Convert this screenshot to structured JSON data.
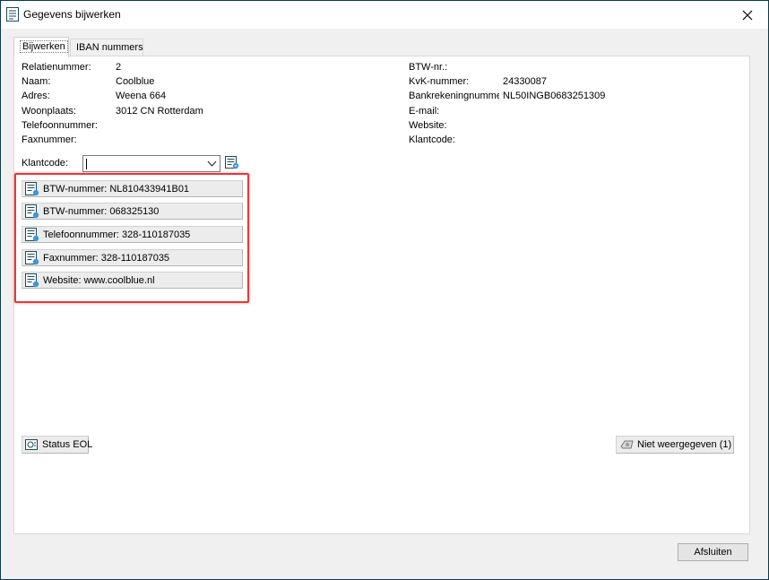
{
  "window": {
    "title": "Gegevens bijwerken",
    "close_label": "×"
  },
  "tabs": [
    {
      "label": "Bijwerken",
      "active": true
    },
    {
      "label": "IBAN nummers",
      "active": false
    }
  ],
  "left_fields": [
    {
      "label": "Relatienummer:",
      "value": "2"
    },
    {
      "label": "Naam:",
      "value": "Coolblue"
    },
    {
      "label": "Adres:",
      "value": "Weena 664"
    },
    {
      "label": "Woonplaats:",
      "value": "3012 CN Rotterdam"
    },
    {
      "label": "Telefoonnummer:",
      "value": ""
    },
    {
      "label": "Faxnummer:",
      "value": ""
    }
  ],
  "right_fields": [
    {
      "label": "BTW-nr.:",
      "value": ""
    },
    {
      "label": "KvK-nummer:",
      "value": "24330087"
    },
    {
      "label": "Bankrekeningnummer:",
      "value": "NL50INGB0683251309"
    },
    {
      "label": "E-mail:",
      "value": ""
    },
    {
      "label": "Website:",
      "value": ""
    },
    {
      "label": "Klantcode:",
      "value": ""
    }
  ],
  "klantcode": {
    "label": "Klantcode:",
    "value": ""
  },
  "suggestions": [
    {
      "label": "BTW-nummer: NL810433941B01"
    },
    {
      "label": "BTW-nummer: 068325130"
    },
    {
      "label": "Telefoonnummer: 328-110187035"
    },
    {
      "label": "Faxnummer: 328-110187035"
    },
    {
      "label": "Website: www.coolblue.nl"
    }
  ],
  "buttons": {
    "status_eol": "Status EOL",
    "niet_weergegeven": "Niet weergegeven (1)",
    "afsluiten": "Afsluiten"
  },
  "colors": {
    "highlight": "#e03a3a",
    "window_border": "#0b3a4a"
  },
  "icons": {
    "title": "form-icon",
    "suggestion": "form-add-icon",
    "status": "status-eol-icon",
    "hidden": "eye-icon"
  }
}
